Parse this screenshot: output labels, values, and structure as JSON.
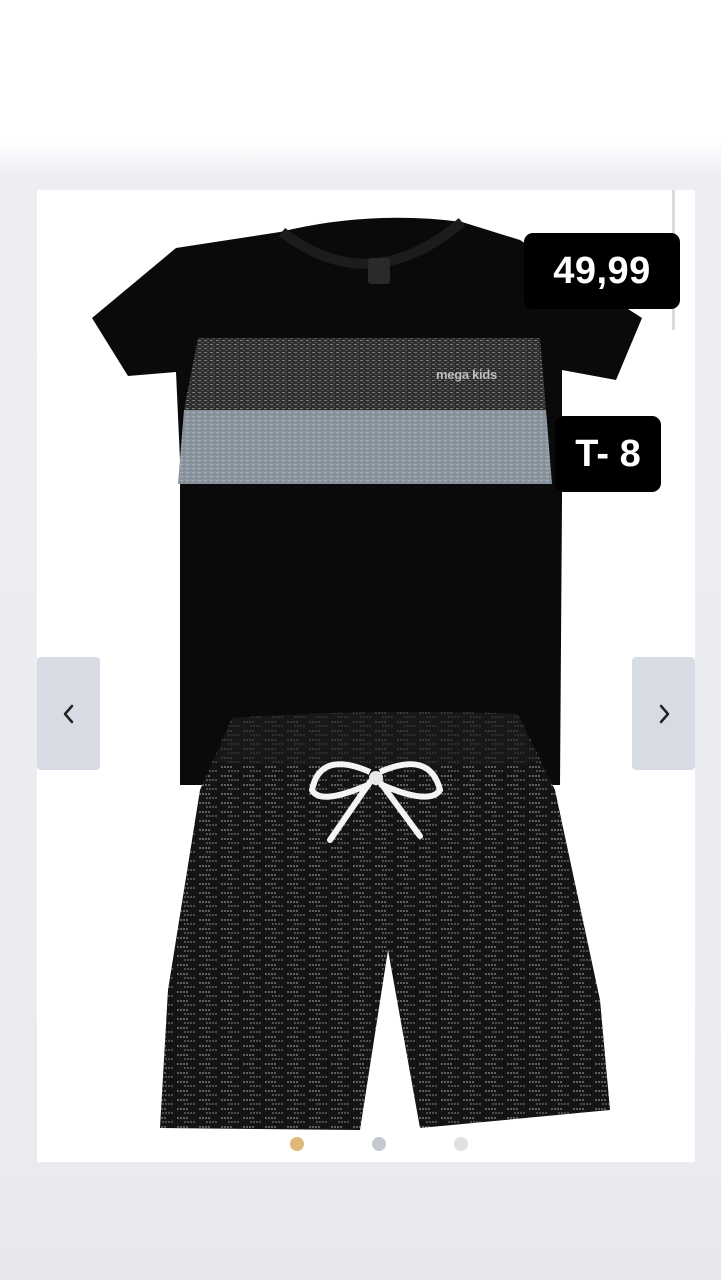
{
  "product": {
    "price": "49,99",
    "size": "T- 8",
    "brand_print": "mega kids"
  },
  "carousel": {
    "prev_icon": "chevron-left-icon",
    "next_icon": "chevron-right-icon",
    "slide_count": 3,
    "active_slide": 1
  },
  "colors": {
    "badge_bg": "#000000",
    "badge_text": "#ffffff",
    "nav_bg": "#d7dbe3",
    "dot_active": "#e0b97a",
    "dot_inactive": "#c6c9cf"
  }
}
